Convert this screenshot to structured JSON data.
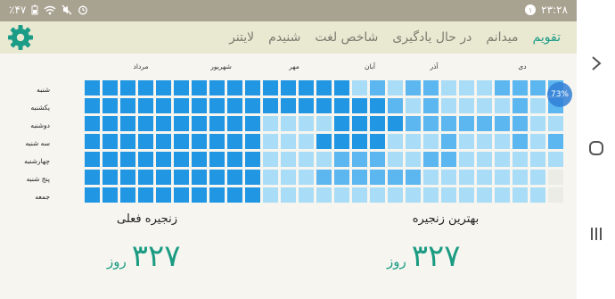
{
  "status": {
    "time": "۲۳:۲۸",
    "battery": "٪۴۷",
    "notification_count": "۱"
  },
  "tabs": [
    "تقویم",
    "میدانم",
    "در حال یادگیری",
    "شاخص لغت",
    "شنیدم",
    "لایتنر"
  ],
  "active_tab": 0,
  "months": [
    "دی",
    "آذر",
    "آبان",
    "مهر",
    "شهریور",
    "مرداد"
  ],
  "days": [
    "شنبه",
    "یکشنبه",
    "دوشنبه",
    "سه شنبه",
    "چهارشنبه",
    "پنج شنبه",
    "جمعه"
  ],
  "progress_label": "73%",
  "stats": {
    "best_streak_label": "بهترین زنجیره",
    "best_streak_value": "۳۲۷",
    "current_streak_label": "زنجیره فعلی",
    "current_streak_value": "۳۲۷",
    "unit": "روز"
  },
  "colors": {
    "accent": "#1b9c87",
    "strong": "#2196e3",
    "medium": "#5cb6ef",
    "light": "#a9dcf7",
    "empty": "#ecece7"
  },
  "heatmap": {
    "columns": 27,
    "rows": 7,
    "levels": [
      "333333333333333121221112222",
      "333333333333333332121111212",
      "333333333311113333222222211",
      "333333333311133331112111212",
      "333333333311112221122111111",
      "333333333311122222211111110",
      "333333333311111111111111110"
    ]
  },
  "nav": {
    "back": "back-icon",
    "home": "home-icon",
    "recents": "recents-icon"
  }
}
